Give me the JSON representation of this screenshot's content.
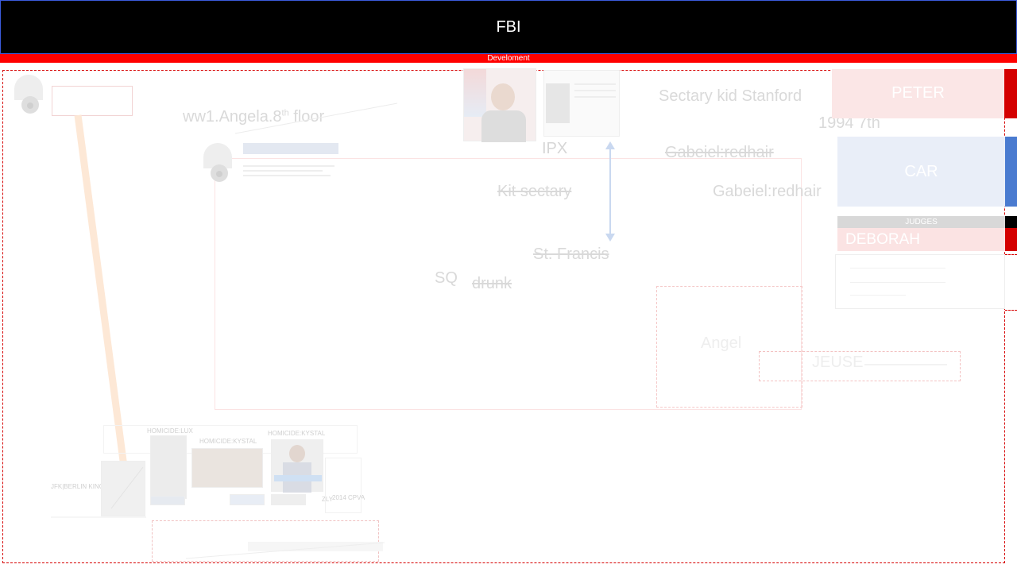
{
  "header": {
    "title": "FBI",
    "subtitle": "Develoment"
  },
  "top_left_label": "",
  "labels": {
    "angela": "ww1.Angela.8",
    "angela_sup": "th",
    "angela_tail": " floor",
    "ipx": "IPX",
    "sectary_kid": "Sectary kid Stanford",
    "year": "1994 7th",
    "gabeiel_1": "Gabeiel:redhair",
    "gabeiel_2": "Gabeiel:redhair",
    "kit_sectary": "Kit sectary",
    "st_francis": "St. Francis",
    "sq": "SQ",
    "drunk": "drunk",
    "angel": "Angel",
    "jeuse": "JEUSE"
  },
  "right_panel": {
    "peter": "PETER",
    "car": "CAR",
    "judges": "JUDGES",
    "deborah": "DEBORAH"
  },
  "bottom_collage": {
    "homicide_lux": "HOMICIDE:LUX",
    "homicide_kystal_1": "HOMICIDE:KYSTAL",
    "homicide_kystal_2": "HOMICIDE:KYSTAL",
    "berlin": "JFK|BERLIN KING",
    "cpva": "2014 CPVA",
    "zly": "ZLY"
  },
  "colors": {
    "header_bg": "#000000",
    "accent_red": "#ff0000",
    "accent_blue": "#4a7bd0"
  }
}
